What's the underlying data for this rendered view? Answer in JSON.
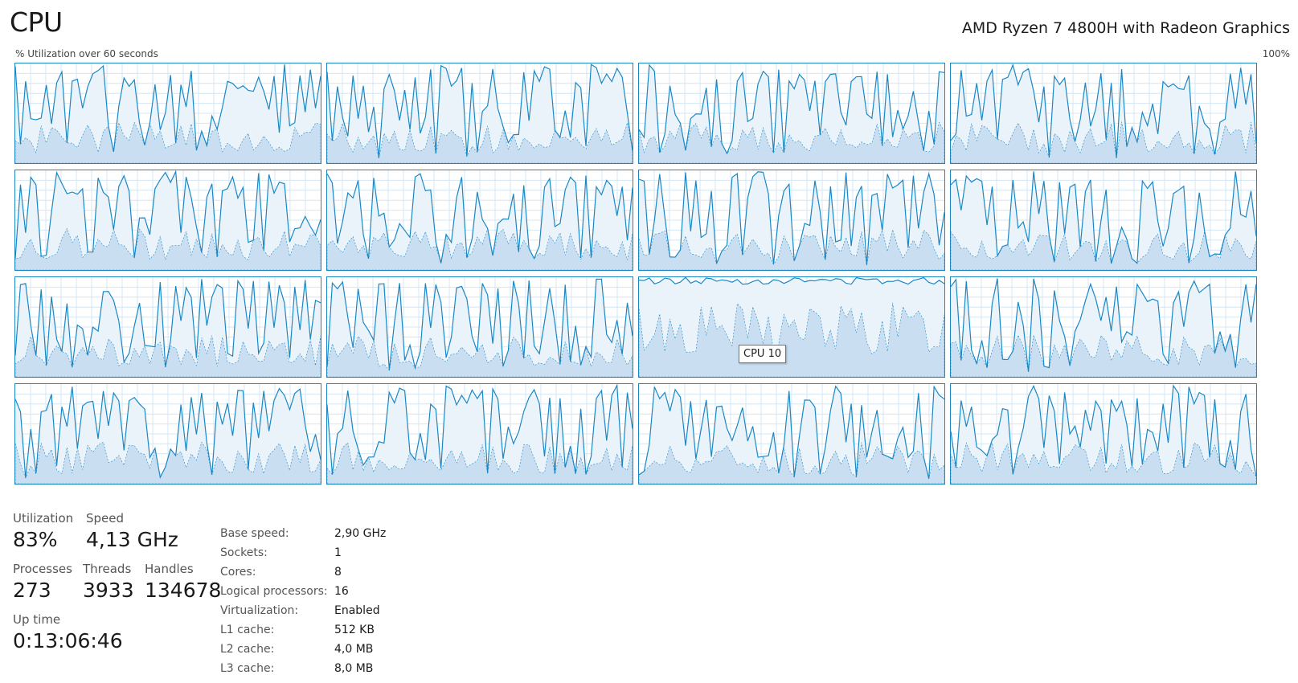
{
  "header": {
    "title": "CPU",
    "processor_name": "AMD Ryzen 7 4800H with Radeon Graphics",
    "utilization_label": "% Utilization over 60 seconds",
    "max_label": "100%"
  },
  "graphs": {
    "count": 16,
    "columns": 4,
    "rows": 4,
    "line_color": "#1a87c5",
    "fill_color": "#eaf3fa",
    "kernel_fill_color": "#c9def0",
    "grid_color": "#d4e6f4",
    "hover_index": 10,
    "tooltip_text": "CPU 10"
  },
  "stats": {
    "utilization": {
      "label": "Utilization",
      "value": "83%"
    },
    "speed": {
      "label": "Speed",
      "value": "4,13 GHz"
    },
    "processes": {
      "label": "Processes",
      "value": "273"
    },
    "threads": {
      "label": "Threads",
      "value": "3933"
    },
    "handles": {
      "label": "Handles",
      "value": "134678"
    },
    "uptime": {
      "label": "Up time",
      "value": "0:13:06:46"
    }
  },
  "details": [
    {
      "key": "Base speed:",
      "value": "2,90 GHz"
    },
    {
      "key": "Sockets:",
      "value": "1"
    },
    {
      "key": "Cores:",
      "value": "8"
    },
    {
      "key": "Logical processors:",
      "value": "16"
    },
    {
      "key": "Virtualization:",
      "value": "Enabled"
    },
    {
      "key": "L1 cache:",
      "value": "512 KB"
    },
    {
      "key": "L2 cache:",
      "value": "4,0 MB"
    },
    {
      "key": "L3 cache:",
      "value": "8,0 MB"
    }
  ]
}
